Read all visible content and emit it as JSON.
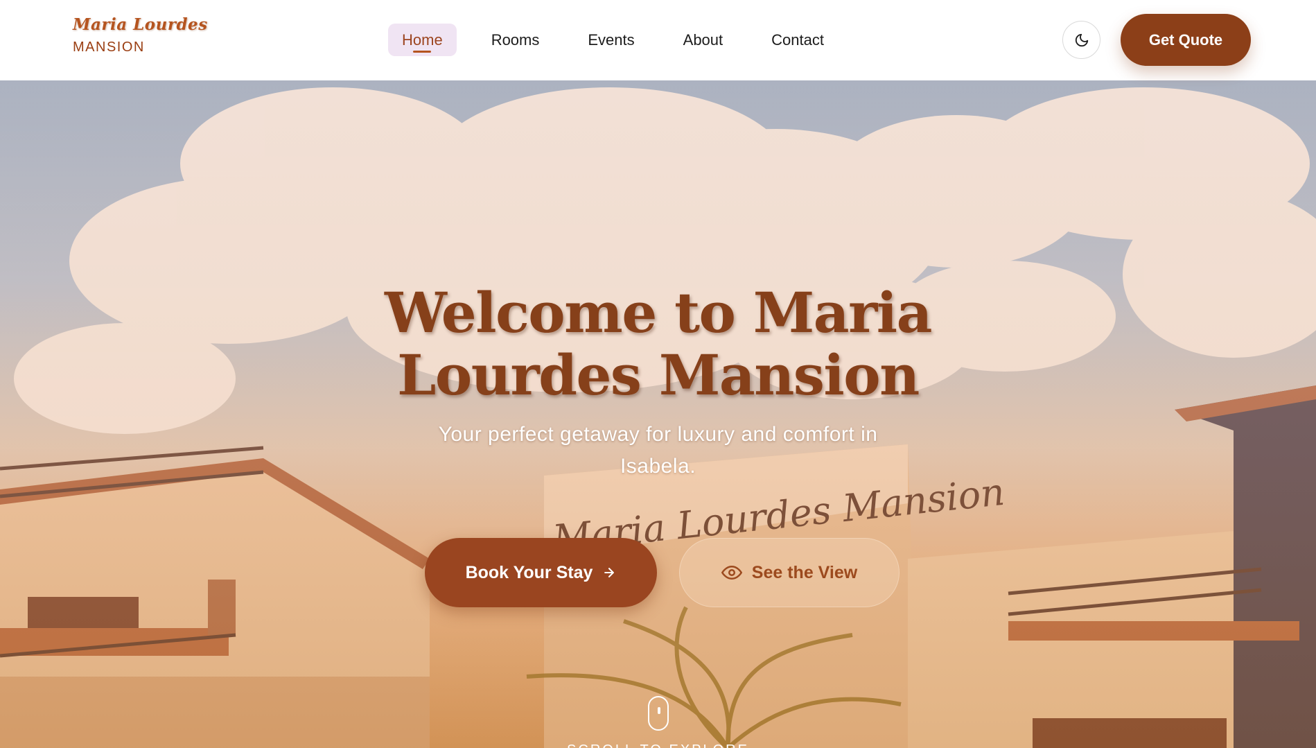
{
  "brand": {
    "script_name": "Maria Lourdes",
    "sub_name": "MANSION",
    "accent_color": "#9c4520"
  },
  "nav": {
    "items": [
      {
        "label": "Home",
        "active": true
      },
      {
        "label": "Rooms",
        "active": false
      },
      {
        "label": "Events",
        "active": false
      },
      {
        "label": "About",
        "active": false
      },
      {
        "label": "Contact",
        "active": false
      }
    ]
  },
  "header": {
    "theme_toggle_icon": "moon-icon",
    "quote_button": "Get Quote"
  },
  "hero": {
    "title_line1": "Welcome to Maria",
    "title_line2": "Lourdes Mansion",
    "subtitle_line1": "Your perfect getaway for luxury and comfort in",
    "subtitle_line2": "Isabela.",
    "signage_text": "Maria Lourdes Mansion",
    "primary_cta": "Book Your Stay",
    "primary_cta_icon": "arrow-right-icon",
    "secondary_cta": "See the View",
    "secondary_cta_icon": "eye-icon",
    "scroll_icon": "mouse-icon",
    "scroll_label": "SCROLL TO EXPLORE"
  }
}
